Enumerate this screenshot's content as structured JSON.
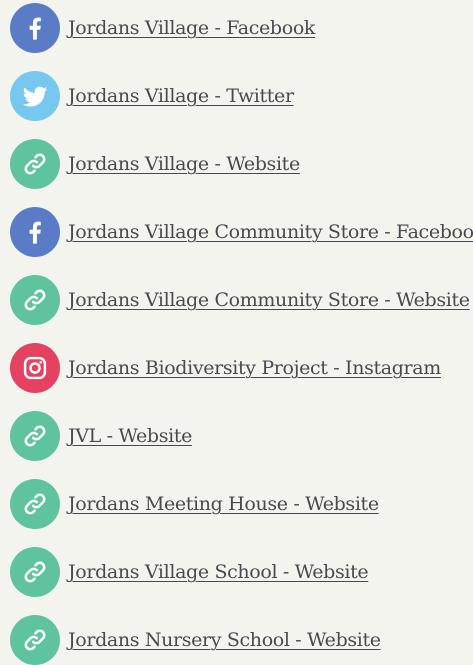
{
  "links": [
    {
      "label": "Jordans Village - Facebook",
      "icon": "facebook-icon",
      "color": "#5a7cc6"
    },
    {
      "label": "Jordans Village - Twitter",
      "icon": "twitter-icon",
      "color": "#77c8ef"
    },
    {
      "label": "Jordans Village - Website",
      "icon": "link-icon",
      "color": "#5fc39d"
    },
    {
      "label": "Jordans Village Community Store - Facebook",
      "icon": "facebook-icon",
      "color": "#5a7cc6"
    },
    {
      "label": "Jordans Village Community Store - Website",
      "icon": "link-icon",
      "color": "#5fc39d"
    },
    {
      "label": "Jordans Biodiversity Project - Instagram",
      "icon": "instagram-icon",
      "color": "#e44260"
    },
    {
      "label": "JVL - Website",
      "icon": "link-icon",
      "color": "#5fc39d"
    },
    {
      "label": "Jordans Meeting House - Website",
      "icon": "link-icon",
      "color": "#5fc39d"
    },
    {
      "label": "Jordans Village School - Website",
      "icon": "link-icon",
      "color": "#5fc39d"
    },
    {
      "label": "Jordans Nursery School - Website",
      "icon": "link-icon",
      "color": "#5fc39d"
    }
  ]
}
